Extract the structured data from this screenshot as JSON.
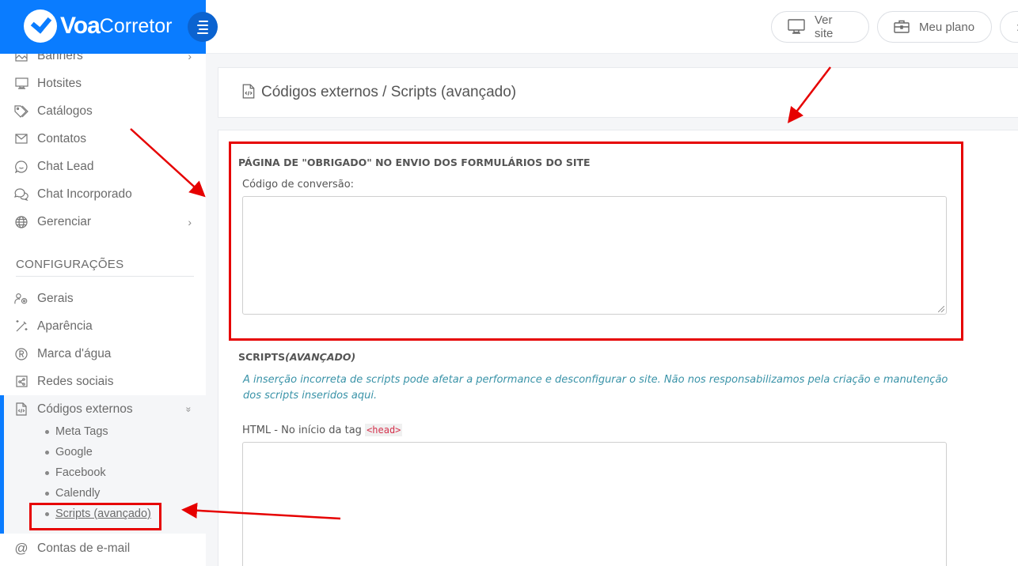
{
  "header": {
    "logo_bold": "Voa",
    "logo_light": "Corretor",
    "buttons": [
      {
        "label": "Ver site",
        "icon": "monitor-icon"
      },
      {
        "label": "Meu plano",
        "icon": "briefcase-icon"
      },
      {
        "label": ":",
        "icon": "more-icon"
      }
    ]
  },
  "sidebar": {
    "items": [
      {
        "label": "Banners",
        "icon": "image-icon",
        "has_chevron": true
      },
      {
        "label": "Hotsites",
        "icon": "monitor-icon"
      },
      {
        "label": "Catálogos",
        "icon": "tag-icon"
      },
      {
        "label": "Contatos",
        "icon": "envelope-icon"
      },
      {
        "label": "Chat Lead",
        "icon": "chat-smile-icon"
      },
      {
        "label": "Chat Incorporado",
        "icon": "chats-icon"
      },
      {
        "label": "Gerenciar",
        "icon": "globe-icon",
        "has_chevron": true
      }
    ],
    "section_title": "CONFIGURAÇÕES",
    "config_items": [
      {
        "label": "Gerais",
        "icon": "user-gear-icon"
      },
      {
        "label": "Aparência",
        "icon": "magic-wand-icon"
      },
      {
        "label": "Marca d'água",
        "icon": "registered-icon"
      },
      {
        "label": "Redes sociais",
        "icon": "share-icon"
      }
    ],
    "group": {
      "label": "Códigos externos",
      "icon": "file-code-icon",
      "chevron": "»",
      "sub_items": [
        "Meta Tags",
        "Google",
        "Facebook",
        "Calendly",
        "Scripts (avançado)"
      ],
      "active_sub": "Scripts (avançado)"
    },
    "after_group": [
      {
        "label": "Contas de e-mail",
        "icon": "at-icon"
      }
    ],
    "chevron_char": "›"
  },
  "main": {
    "title": "Códigos externos / Scripts (avançado)",
    "thanks_section": {
      "heading": "PÁGINA DE \"OBRIGADO\" NO ENVIO DOS FORMULÁRIOS DO SITE",
      "field_label": "Código de conversão:",
      "value": ""
    },
    "scripts_section": {
      "heading_plain": "SCRIPTS",
      "heading_italic": "(AVANÇADO)",
      "warning": "A inserção incorreta de scripts pode afetar a performance e desconfigurar o site. Não nos responsabilizamos pela criação e manutenção dos scripts inseridos aqui.",
      "head_label": "HTML - No início da tag",
      "head_tag": "<head>",
      "head_value": ""
    }
  },
  "annotations": {
    "color": "#e60000"
  },
  "colors": {
    "brand": "#0a7cff",
    "warning_text": "#3a93a8",
    "code_tag": "#d6334e"
  }
}
